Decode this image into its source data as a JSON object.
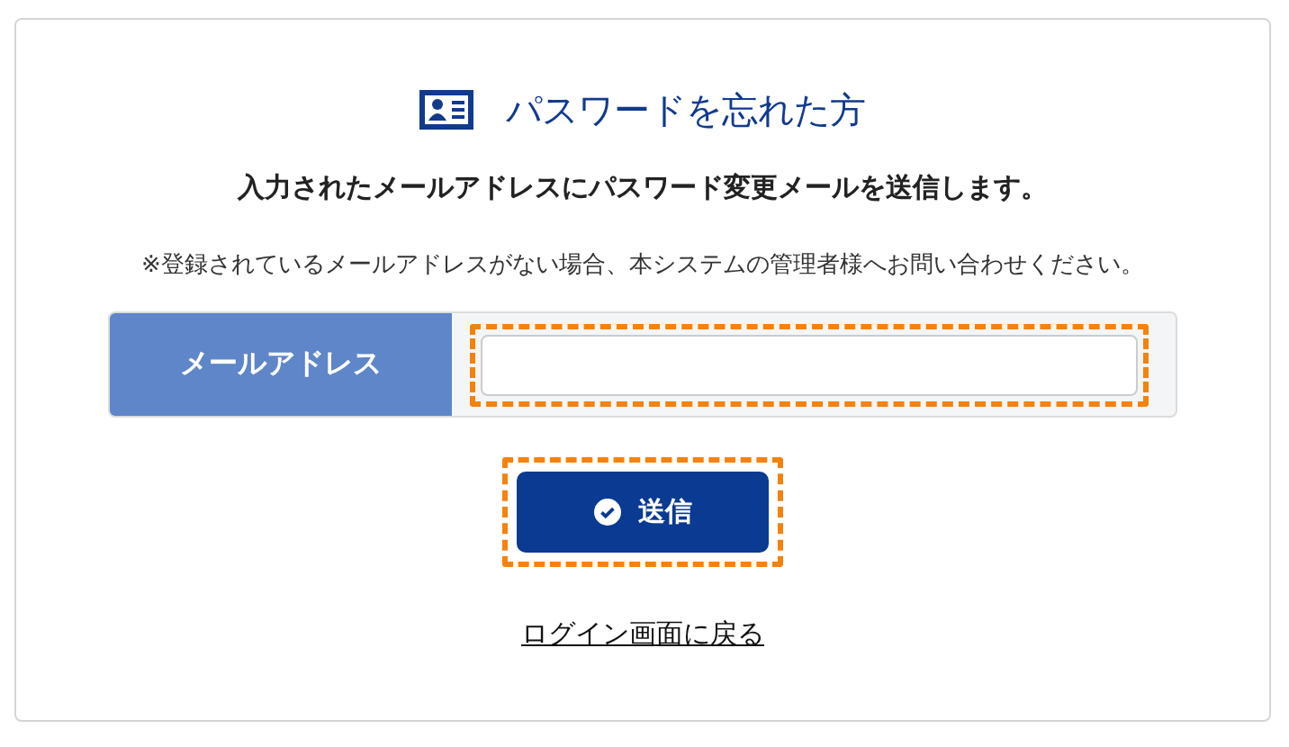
{
  "heading": "パスワードを忘れた方",
  "lead": "入力されたメールアドレスにパスワード変更メールを送信します。",
  "note": "※登録されているメールアドレスがない場合、本システムの管理者様へお問い合わせください。",
  "email_field": {
    "label": "メールアドレス",
    "highlighted": true
  },
  "submit_button": {
    "label": "送信",
    "highlighted": true
  },
  "back_link": "ログイン画面に戻る"
}
